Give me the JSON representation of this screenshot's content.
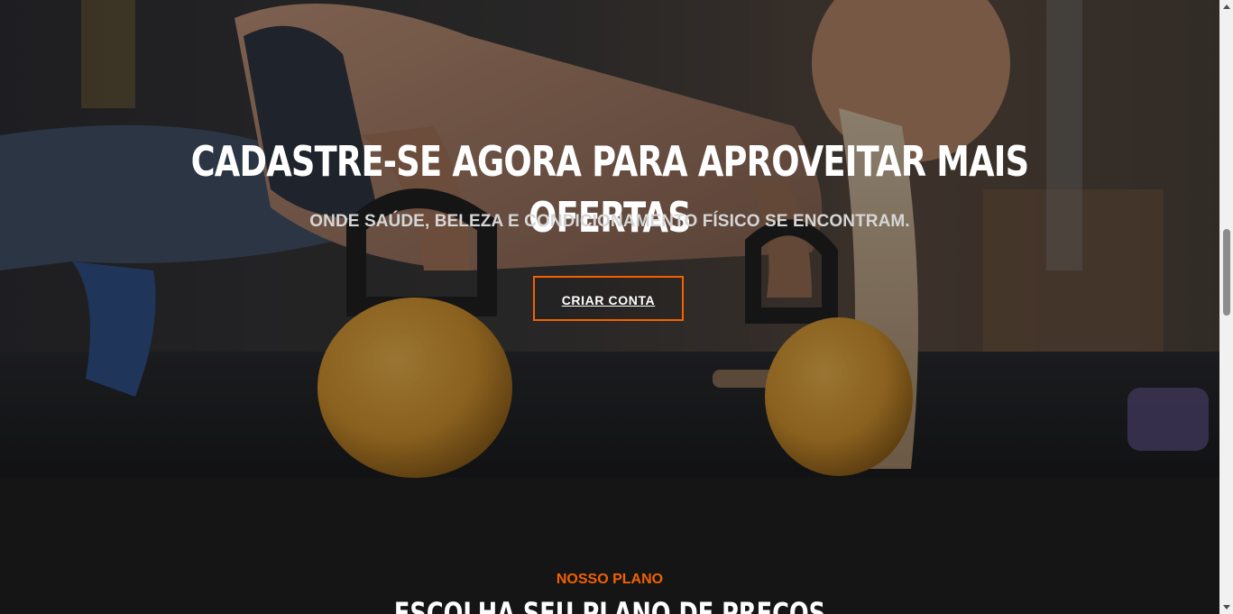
{
  "hero": {
    "title": "CADASTRE-SE AGORA PARA APROVEITAR MAIS OFERTAS",
    "subtitle": "ONDE SAÚDE, BELEZA E CONDICIONAMENTO FÍSICO SE ENCONTRAM.",
    "cta_label": "CRIAR CONTA",
    "image_alt": "woman-doing-pushups-on-kettlebells"
  },
  "pricing": {
    "label": "NOSSO PLANO",
    "title": "ESCOLHA SEU PLANO DE PREÇOS"
  },
  "colors": {
    "accent": "#f36100",
    "background": "#151515",
    "text": "#ffffff"
  },
  "scrollbar": {
    "position_fraction": 0.37
  }
}
